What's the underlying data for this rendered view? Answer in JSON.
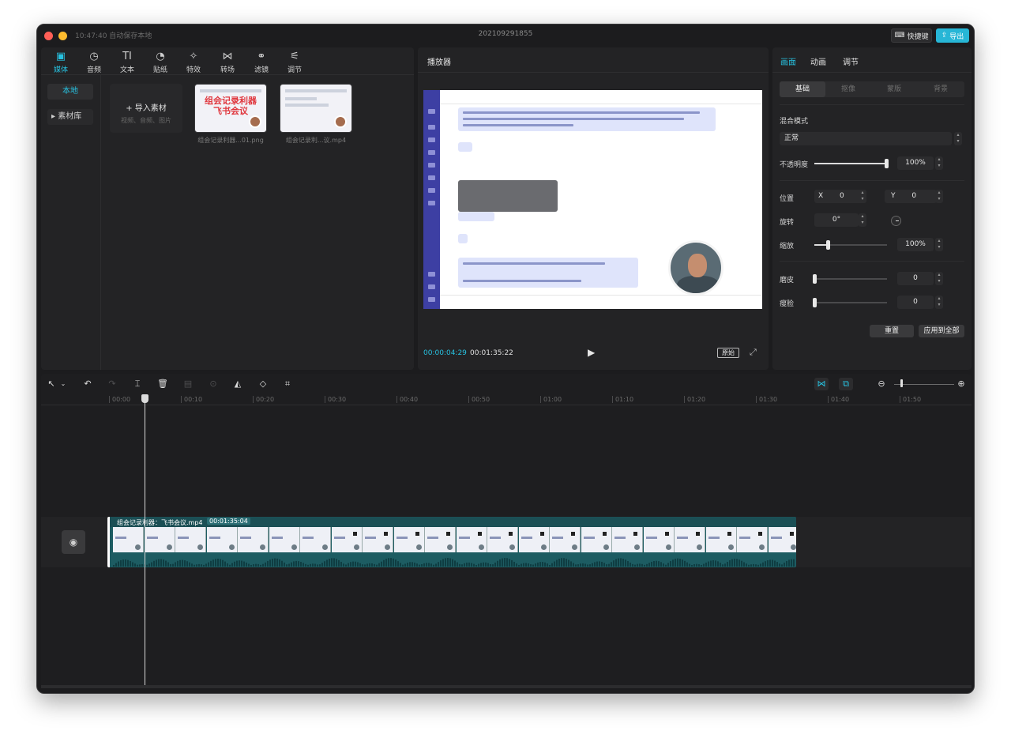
{
  "titlebar": {
    "autosave": "10:47:40 自动保存本地",
    "project_title": "202109291855",
    "shortcut_label": "快捷键",
    "export_label": "导出"
  },
  "media_tools": [
    {
      "label": "媒体",
      "icon": "media-icon",
      "glyph": "▣",
      "active": true
    },
    {
      "label": "音频",
      "icon": "audio-icon",
      "glyph": "◷",
      "active": false
    },
    {
      "label": "文本",
      "icon": "text-icon",
      "glyph": "TI",
      "active": false
    },
    {
      "label": "贴纸",
      "icon": "sticker-icon",
      "glyph": "◔",
      "active": false
    },
    {
      "label": "特效",
      "icon": "effects-icon",
      "glyph": "✧",
      "active": false
    },
    {
      "label": "转场",
      "icon": "transition-icon",
      "glyph": "⋈",
      "active": false
    },
    {
      "label": "滤镜",
      "icon": "filter-icon",
      "glyph": "⚭",
      "active": false
    },
    {
      "label": "调节",
      "icon": "adjust-icon",
      "glyph": "⚟",
      "active": false
    }
  ],
  "media_sidebar": {
    "local": "本地",
    "library": "素材库"
  },
  "import": {
    "label": "导入素材",
    "hint": "视频、音频、图片"
  },
  "thumbnails": [
    {
      "caption": "组会记录利器...01.png",
      "headline": "组会记录利器\n飞书会议"
    },
    {
      "caption": "组会记录利...议.mp4"
    }
  ],
  "player": {
    "title": "播放器",
    "current_time": "00:00:04:29",
    "total_time": "00:01:35:22",
    "ratio_label": "原始"
  },
  "props": {
    "tabs": [
      "画面",
      "动画",
      "调节"
    ],
    "subtabs": [
      "基础",
      "抠像",
      "蒙版",
      "背景"
    ],
    "blend_label": "混合模式",
    "blend_value": "正常",
    "opacity_label": "不透明度",
    "opacity_value": "100%",
    "opacity_level": 1.0,
    "position_label": "位置",
    "x_label": "X",
    "x_value": "0",
    "y_label": "Y",
    "y_value": "0",
    "rotation_label": "旋转",
    "rotation_value": "0°",
    "scale_label": "缩放",
    "scale_value": "100%",
    "scale_level": 0.2,
    "smooth_label": "磨皮",
    "smooth_value": "0",
    "slim_label": "瘦脸",
    "slim_value": "0",
    "reset_label": "重置",
    "apply_all_label": "应用到全部"
  },
  "timeline": {
    "ruler": [
      "00:00",
      "00:10",
      "00:20",
      "00:30",
      "00:40",
      "00:50",
      "01:00",
      "01:10",
      "01:20",
      "01:30",
      "01:40",
      "01:50"
    ],
    "clip_name": "组会记录利器：飞书会议.mp4",
    "clip_duration": "00:01:35:04"
  }
}
